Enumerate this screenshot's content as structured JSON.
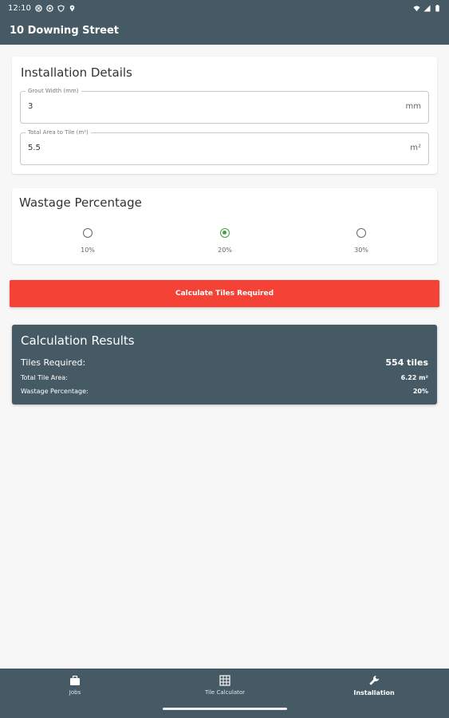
{
  "status_bar": {
    "time": "12:10"
  },
  "app_bar": {
    "title": "10 Downing Street"
  },
  "installation_details": {
    "title": "Installation Details",
    "grout_width": {
      "label": "Grout Width (mm)",
      "value": "3",
      "suffix": "mm"
    },
    "total_area": {
      "label": "Total Area to Tile (m²)",
      "value": "5.5",
      "suffix": "m²"
    }
  },
  "wastage": {
    "title": "Wastage Percentage",
    "options": [
      {
        "label": "10%",
        "selected": false
      },
      {
        "label": "20%",
        "selected": true
      },
      {
        "label": "30%",
        "selected": false
      }
    ]
  },
  "calculate_button": {
    "label": "Calculate Tiles Required"
  },
  "results": {
    "title": "Calculation Results",
    "tiles_required_label": "Tiles Required:",
    "tiles_required_value": "554 tiles",
    "total_tile_area_label": "Total Tile Area:",
    "total_tile_area_value": "6.22 m²",
    "wastage_label": "Wastage Percentage:",
    "wastage_value": "20%"
  },
  "bottom_nav": {
    "items": [
      {
        "label": "Jobs",
        "icon": "briefcase-icon",
        "active": false
      },
      {
        "label": "Tile Calculator",
        "icon": "grid-icon",
        "active": false
      },
      {
        "label": "Installation",
        "icon": "wrench-icon",
        "active": true
      }
    ]
  },
  "colors": {
    "primary": "#455a64",
    "accent_button": "#f44336",
    "radio_selected": "#43a047"
  }
}
